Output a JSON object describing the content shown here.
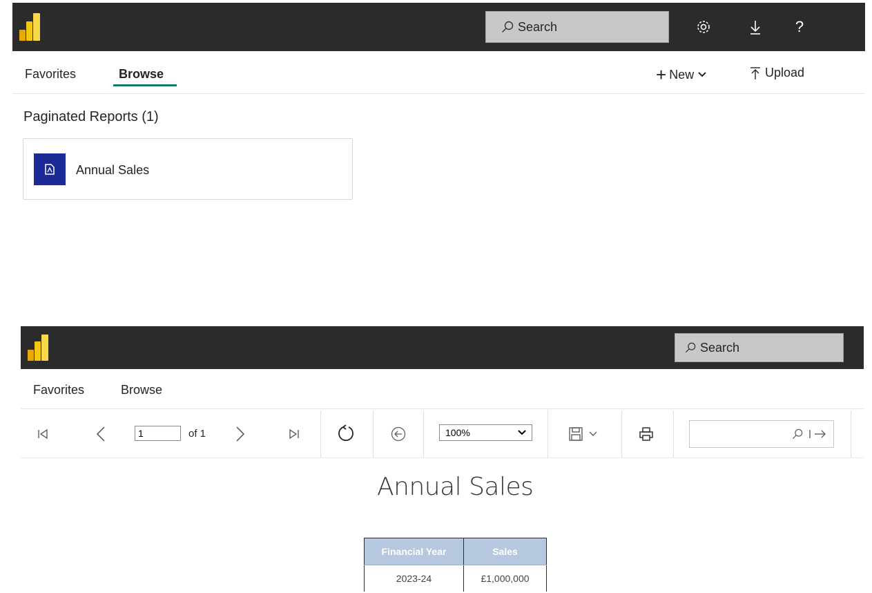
{
  "top_portal": {
    "search_placeholder": "Search",
    "icons": [
      "gear-icon",
      "download-icon",
      "help-icon"
    ],
    "help_label": "?",
    "nav": {
      "favorites": "Favorites",
      "browse": "Browse"
    },
    "actions": {
      "new_label": "New",
      "upload_label": "Upload"
    },
    "section_title": "Paginated Reports (1)",
    "reports": [
      {
        "name": "Annual Sales"
      }
    ]
  },
  "viewer": {
    "search_placeholder": "Search",
    "nav": {
      "favorites": "Favorites",
      "browse": "Browse"
    },
    "toolbar": {
      "page_value": "1",
      "of_label": "of 1",
      "zoom_value": "100%"
    },
    "report": {
      "title": "Annual Sales",
      "table": {
        "headers": [
          "Financial Year",
          "Sales"
        ],
        "rows": [
          [
            "2023-24",
            "£1,000,000"
          ]
        ]
      }
    }
  },
  "colors": {
    "topbar": "#2b2b2b",
    "accent_underline": "#117865",
    "report_tile": "#1b2a96",
    "table_header": "#b6c8df",
    "logo_yellow": "#f2c811"
  }
}
